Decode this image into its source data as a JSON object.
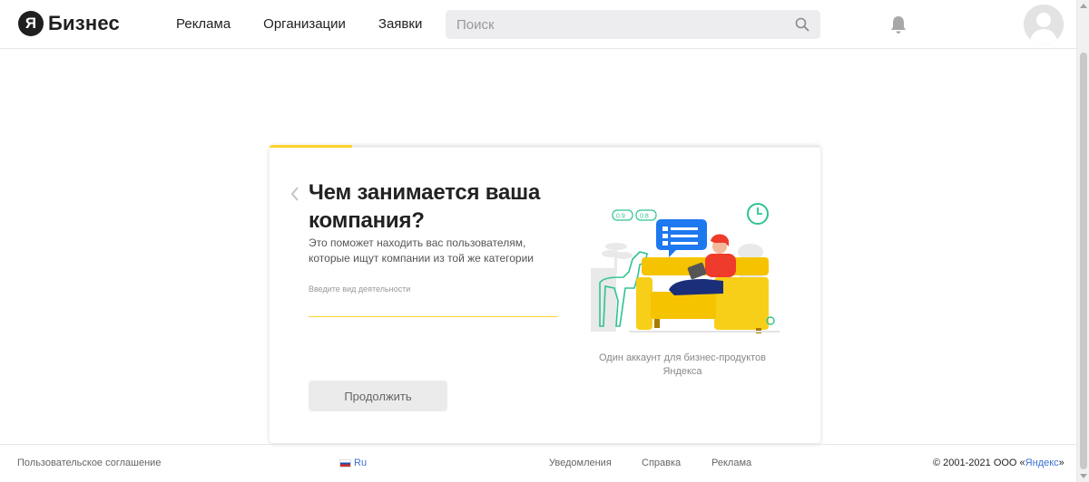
{
  "header": {
    "logo_letter": "Я",
    "logo_text": "Бизнес",
    "nav": [
      "Реклама",
      "Организации",
      "Заявки"
    ],
    "search_placeholder": "Поиск"
  },
  "card": {
    "progress_percent": 15,
    "title": "Чем занимается ваша компания?",
    "subtitle": "Это поможет находить вас пользователям, которые ищут компании из той же категории",
    "field_label": "Введите вид деятельности",
    "continue_label": "Продолжить",
    "caption": "Один аккаунт для бизнес-продуктов Яндекса",
    "illustration_badges": [
      "0.9",
      "0.8"
    ]
  },
  "footer": {
    "agreement": "Пользовательское соглашение",
    "language": "Ru",
    "notifications": "Уведомления",
    "help": "Справка",
    "ads": "Реклама",
    "copyright_prefix": "© 2001-2021 ООО «",
    "company": "Яндекс",
    "copyright_suffix": "»"
  },
  "colors": {
    "accent": "#fed42b",
    "link": "#3c6fd4",
    "button_bg": "#ebebeb"
  }
}
